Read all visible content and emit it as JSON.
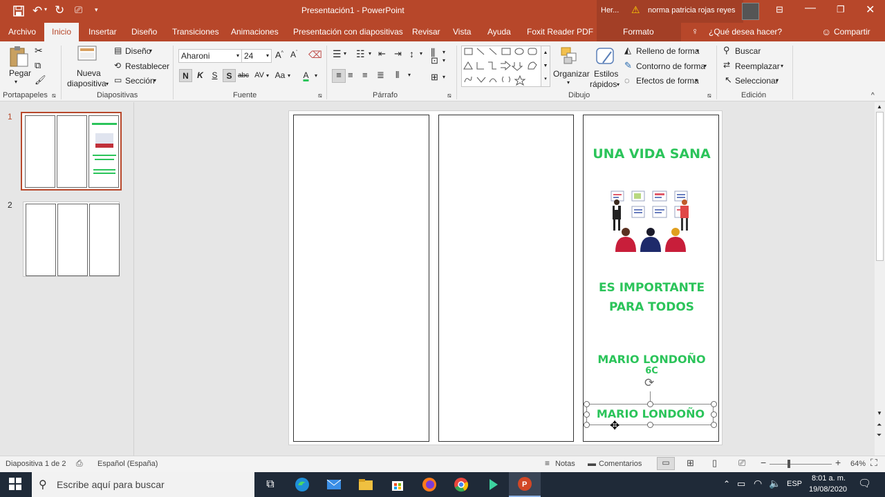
{
  "titlebar": {
    "doc_title": "Presentación1  -  PowerPoint",
    "context_label": "Her...",
    "user_name": "norma patricia rojas reyes"
  },
  "tabs": [
    "Archivo",
    "Inicio",
    "Insertar",
    "Diseño",
    "Transiciones",
    "Animaciones",
    "Presentación con diapositivas",
    "Revisar",
    "Vista",
    "Ayuda",
    "Foxit Reader PDF",
    "Formato"
  ],
  "tell_me": "¿Qué desea hacer?",
  "share": "Compartir",
  "ribbon": {
    "paste": "Pegar",
    "new_slide_1": "Nueva",
    "new_slide_2": "diapositiva",
    "layout": "Diseño",
    "reset": "Restablecer",
    "section": "Sección",
    "font_name": "Aharoni",
    "font_size": "24",
    "bold": "N",
    "italic": "K",
    "underline": "S",
    "shadow": "S",
    "strike": "abc",
    "spacing": "AV",
    "case": "Aa",
    "fontcolor": "A",
    "arrange": "Organizar",
    "quick_styles_1": "Estilos",
    "quick_styles_2": "rápidos",
    "shape_fill": "Relleno de forma",
    "shape_outline": "Contorno de forma",
    "shape_effects": "Efectos de forma",
    "find": "Buscar",
    "replace": "Reemplazar",
    "select": "Seleccionar",
    "groups": [
      "Portapapeles",
      "Diapositivas",
      "Fuente",
      "Párrafo",
      "Dibujo",
      "Edición"
    ]
  },
  "thumbnails": [
    {
      "number": "1"
    },
    {
      "number": "2"
    }
  ],
  "slide": {
    "title": "UNA VIDA SANA",
    "line1": "ES IMPORTANTE",
    "line2": "PARA TODOS",
    "author": "MARIO LONDOÑO",
    "grade": "6C",
    "author_selected": "MARIO LONDOÑO"
  },
  "status": {
    "slide_info": "Diapositiva 1 de 2",
    "language": "Español (España)",
    "notes": "Notas",
    "comments": "Comentarios",
    "zoom": "64%"
  },
  "taskbar": {
    "search_placeholder": "Escribe aquí para buscar",
    "lang": "ESP",
    "time": "8:01 a. m.",
    "date": "19/08/2020"
  },
  "colors": {
    "accent": "#b7472a",
    "slide_text": "#2bc45a"
  }
}
